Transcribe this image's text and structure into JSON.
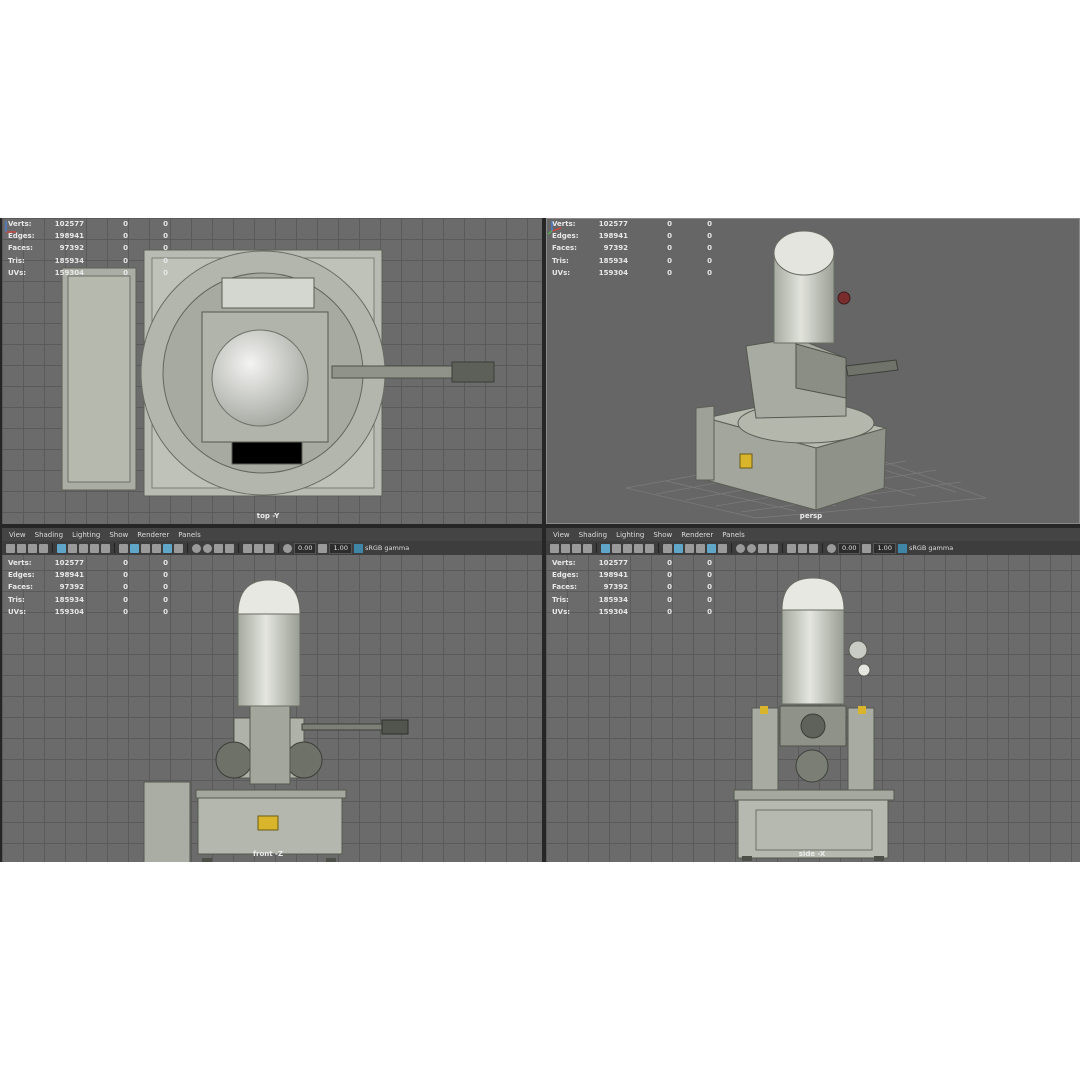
{
  "stats": {
    "rows": [
      {
        "label": "Verts:",
        "a": "102577",
        "b": "0",
        "c": "0"
      },
      {
        "label": "Edges:",
        "a": "198941",
        "b": "0",
        "c": "0"
      },
      {
        "label": "Faces:",
        "a": "97392",
        "b": "0",
        "c": "0"
      },
      {
        "label": "Tris:",
        "a": "185934",
        "b": "0",
        "c": "0"
      },
      {
        "label": "UVs:",
        "a": "159304",
        "b": "0",
        "c": "0"
      }
    ]
  },
  "viewports": {
    "top": {
      "label": "top -Y"
    },
    "persp": {
      "label": "persp"
    },
    "front": {
      "label": "front -Z"
    },
    "side": {
      "label": "side -X"
    }
  },
  "panel_menu": {
    "items": [
      "View",
      "Shading",
      "Lighting",
      "Show",
      "Renderer",
      "Panels"
    ]
  },
  "toolbar": {
    "exposure": "0.00",
    "gamma": "1.00",
    "colorspace": "sRGB gamma"
  },
  "colors": {
    "viewport_bg": "#6b6b6b",
    "grid": "#5a5a5a",
    "menubar": "#444444",
    "toolbar": "#3d3d3d",
    "model": "#b9bdb3",
    "highlight": "#5fa6c9"
  }
}
